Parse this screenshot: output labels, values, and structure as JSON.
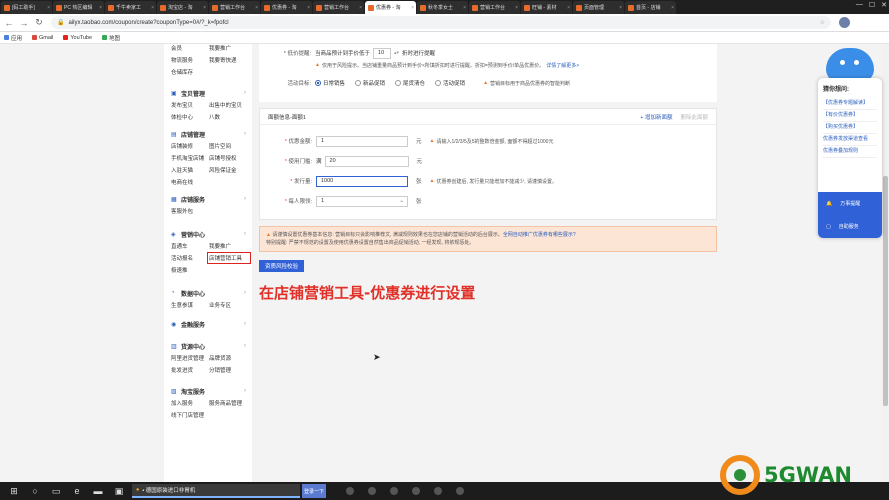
{
  "browser": {
    "tabs": [
      {
        "title": "[码工助手]",
        "active": false
      },
      {
        "title": "PC 热区编辑",
        "active": false
      },
      {
        "title": "千牛卖家工",
        "active": false
      },
      {
        "title": "淘宝店 - 淘",
        "active": false
      },
      {
        "title": "营销工作台",
        "active": false
      },
      {
        "title": "优惠券 - 淘",
        "active": false
      },
      {
        "title": "营销工作台",
        "active": false
      },
      {
        "title": "优惠券 - 淘",
        "active": true
      },
      {
        "title": "秋冬季女士",
        "active": false
      },
      {
        "title": "营销工作台",
        "active": false
      },
      {
        "title": "旺铺 - 素材",
        "active": false
      },
      {
        "title": "页面管理",
        "active": false
      },
      {
        "title": "首页 - 店铺",
        "active": false
      }
    ],
    "url": "ailyx.taobao.com/coupon/create?couponType=0#/?_k=fpofcl",
    "bookmarks": [
      "应用",
      "Gmail",
      "YouTube",
      "地图"
    ]
  },
  "sidebar": {
    "top_items": [
      "会员",
      "我要推广",
      "物流服务",
      "我要寄快递",
      "仓储库存"
    ],
    "groups": [
      {
        "title": "宝贝管理",
        "items": [
          "发布宝贝",
          "出售中的宝贝",
          "体检中心",
          "八数"
        ]
      },
      {
        "title": "店铺管理",
        "items": [
          "店铺装修",
          "图片空间",
          "手机淘宝店铺",
          "店铺号授权",
          "入驻天猫",
          "风险保证金",
          "电商在线"
        ]
      },
      {
        "title": "店铺服务",
        "items": [
          "客服外包"
        ]
      },
      {
        "title": "营销中心",
        "items": [
          "直通车",
          "我要推广",
          "活动报名",
          "店铺营销工具",
          "极速推"
        ]
      },
      {
        "title": "数据中心",
        "items": [
          "生意参谋",
          "业务专区"
        ]
      },
      {
        "title": "金融服务",
        "items": []
      },
      {
        "title": "货源中心",
        "items": [
          "阿里进货管理",
          "品牌货源",
          "批发进货",
          "分销管理"
        ]
      },
      {
        "title": "淘宝服务",
        "items": [
          "加入服务",
          "服务商品管理",
          "线下门店管理"
        ]
      }
    ]
  },
  "form": {
    "price_alert_label": "* 低价提醒:",
    "price_alert_text": "当商品预计到手价低于",
    "price_alert_value": "10",
    "price_alert_suffix": "折时进行提醒",
    "risk_note": "仅用于风险提示。当店铺重量商品预计到手价<所填折扣时进行提醒。折扣=预测到手价/单品优惠价。",
    "risk_link": "详情了解更多>",
    "activity_label": "活动目标:",
    "activity_options": [
      {
        "label": "日常销售",
        "checked": true
      },
      {
        "label": "新品促销",
        "checked": false
      },
      {
        "label": "尾货清仓",
        "checked": false
      },
      {
        "label": "活动促销",
        "checked": false
      }
    ],
    "activity_note": "营销目标用于商品优惠券的智能判断",
    "section_title": "面额信息-面额1",
    "add_face_value": "+ 增加新面额",
    "delete_face_value": "删除此面额",
    "amount_label": "优惠金额:",
    "amount_value": "1",
    "amount_unit": "元",
    "amount_warn": "请输入1/2/3/5及5的整数倍金额, 面额不得超过1000元",
    "threshold_label": "使用门槛:",
    "threshold_prefix": "满",
    "threshold_value": "20",
    "threshold_unit": "元",
    "issue_label": "发行量:",
    "issue_value": "1000",
    "issue_unit": "张",
    "issue_warn": "优惠券创建后, 发行量只能增加不能减少, 请谨慎设置。",
    "limit_label": "每人限领:",
    "limit_value": "1",
    "limit_unit": "张",
    "notice_line1": "请谨慎设置优惠券基本信息: 营销目标只会影响推荐文, 满减规则效果也在您店铺的营销活动的后台展示。",
    "notice_link": "全网自动推广优惠券有哪些展示?",
    "notice_line2": "特别提醒: 严禁不规范的设置及使用优惠券设置自然售出商品促销活动, 一经发现, 将依规惩处。",
    "submit_button": "资质风险校验"
  },
  "caption": "在店铺营销工具-优惠券进行设置",
  "helper": {
    "title": "猜你想问:",
    "questions": [
      "【优惠券专题解读】",
      "【有价优惠券】",
      "【购买优惠券】",
      "优惠券发放渠道查看",
      "优惠券叠加规则"
    ],
    "buttons": [
      "万事提醒",
      "自助服务"
    ]
  },
  "taskbar": {
    "app_label": "• 德国原装进口非胃机",
    "app2_label": "登录一下"
  },
  "watermark": "5GWAN",
  "brand_colors": {
    "primary": "#3161d6",
    "warning": "#e8732f",
    "caption": "#e03028"
  }
}
